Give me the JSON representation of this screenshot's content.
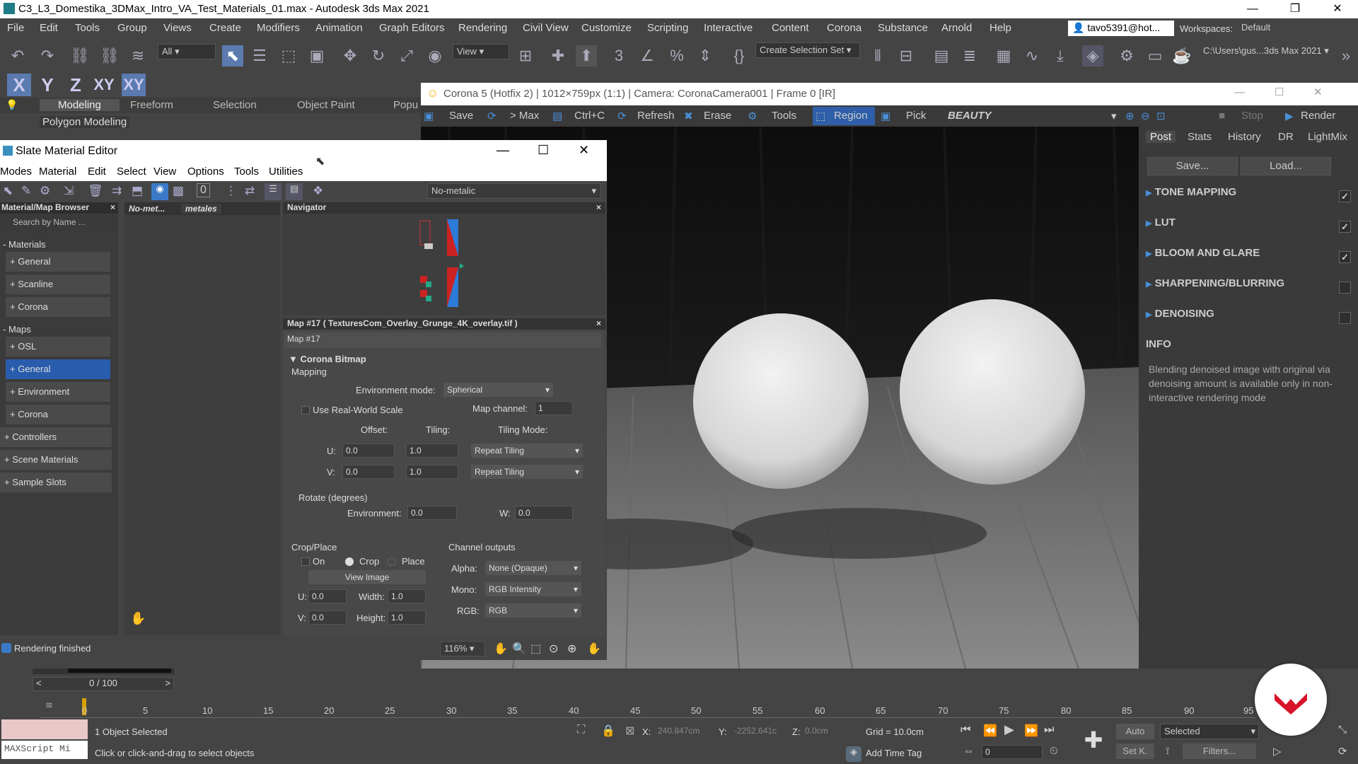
{
  "app": {
    "title": "C3_L3_Domestika_3DMax_Intro_VA_Test_Materials_01.max - Autodesk 3ds Max 2021",
    "menu": [
      "File",
      "Edit",
      "Tools",
      "Group",
      "Views",
      "Create",
      "Modifiers",
      "Animation",
      "Graph Editors",
      "Rendering",
      "Civil View",
      "Customize",
      "Scripting",
      "Interactive",
      "Content",
      "Corona",
      "Substance",
      "Arnold",
      "Help"
    ],
    "user": "tavo5391@hot...",
    "workspaces_label": "Workspaces:",
    "workspace": "Default",
    "selection_filter": "All",
    "ref_coord": "View",
    "selection_set": "Create Selection Set",
    "project_path": "C:\\Users\\gus...3ds Max 2021",
    "axes": [
      "X",
      "Y",
      "Z",
      "XY",
      "XY"
    ],
    "ribbon_tabs": [
      "Modeling",
      "Freeform",
      "Selection",
      "Object Paint",
      "Popu"
    ],
    "ribbon_sub": "Polygon Modeling"
  },
  "corona": {
    "title": "Corona 5 (Hotfix 2) | 1012×759px (1:1) | Camera: CoronaCamera001 | Frame 0 [IR]",
    "toolbar": {
      "save": "Save",
      "max": "> Max",
      "copy": "Ctrl+C",
      "refresh": "Refresh",
      "erase": "Erase",
      "tools": "Tools",
      "region": "Region",
      "pick": "Pick",
      "pass": "BEAUTY",
      "stop": "Stop",
      "render": "Render"
    },
    "panel_tabs": [
      "Post",
      "Stats",
      "History",
      "DR",
      "LightMix"
    ],
    "save_btn": "Save...",
    "load_btn": "Load...",
    "sections": [
      {
        "label": "TONE MAPPING",
        "checked": "✓"
      },
      {
        "label": "LUT",
        "checked": "✓"
      },
      {
        "label": "BLOOM AND GLARE",
        "checked": "✓"
      },
      {
        "label": "SHARPENING/BLURRING",
        "checked": ""
      },
      {
        "label": "DENOISING",
        "checked": ""
      }
    ],
    "info_title": "INFO",
    "info_text": "Blending denoised image with original via denoising amount is available only in non-interactive rendering mode"
  },
  "slate": {
    "title": "Slate Material Editor",
    "menu": [
      "Modes",
      "Material",
      "Edit",
      "Select",
      "View",
      "Options",
      "Tools",
      "Utilities"
    ],
    "view_dropdown": "No-metalic",
    "browser_title": "Material/Map Browser",
    "search_placeholder": "Search by Name ...",
    "materials_head": "- Materials",
    "materials": [
      "+ General",
      "+ Scanline",
      "+ Corona"
    ],
    "maps_head": "- Maps",
    "maps": [
      "+ OSL",
      "+ General",
      "+ Environment",
      "+ Corona"
    ],
    "extra": [
      "+ Controllers",
      "+ Scene Materials",
      "+ Sample Slots"
    ],
    "view_tabs": [
      "No-met...",
      "metales"
    ],
    "navigator": "Navigator",
    "map_header": "Map #17 ( TexturesCom_Overlay_Grunge_4K_overlay.tif )",
    "map_name": "Map #17",
    "rollout": "Corona Bitmap",
    "mapping": "Mapping",
    "env_mode_label": "Environment mode:",
    "env_mode": "Spherical",
    "real_world": "Use Real-World Scale",
    "map_channel_label": "Map channel:",
    "map_channel": "1",
    "offset": "Offset:",
    "tiling": "Tiling:",
    "tiling_mode": "Tiling Mode:",
    "u_label": "U:",
    "v_label": "V:",
    "u_offset": "0.0",
    "u_tiling": "1.0",
    "u_mode": "Repeat Tiling",
    "v_offset": "0.0",
    "v_tiling": "1.0",
    "v_mode": "Repeat Tiling",
    "rotate": "Rotate (degrees)",
    "environment_label": "Environment:",
    "environment": "0.0",
    "w_label": "W:",
    "w": "0.0",
    "crop_place": "Crop/Place",
    "on": "On",
    "crop": "Crop",
    "place": "Place",
    "view_image": "View Image",
    "crop_u_label": "U:",
    "crop_u": "0.0",
    "crop_v_label": "V:",
    "crop_v": "0.0",
    "width_label": "Width:",
    "width": "1.0",
    "height_label": "Height:",
    "height": "1.0",
    "channel_outputs": "Channel outputs",
    "alpha_label": "Alpha:",
    "alpha": "None (Opaque)",
    "mono_label": "Mono:",
    "mono": "RGB Intensity",
    "rgb_label": "RGB:",
    "rgb": "RGB",
    "status": "Rendering finished",
    "zoom": "116%"
  },
  "timeline": {
    "frame": "0 / 100",
    "ticks": [
      "0",
      "5",
      "10",
      "15",
      "20",
      "25",
      "30",
      "35",
      "40",
      "45",
      "50",
      "55",
      "60",
      "65",
      "70",
      "75",
      "80",
      "85",
      "90",
      "95"
    ]
  },
  "status": {
    "maxscript": "MAXScript Mi",
    "selected": "1 Object Selected",
    "hint": "Click or click-and-drag to select objects",
    "x_label": "X:",
    "x": "240.847cm",
    "y_label": "Y:",
    "y": "-2252.641c",
    "z_label": "Z:",
    "z": "0.0cm",
    "grid": "Grid = 10.0cm",
    "add_time_tag": "Add Time Tag",
    "auto": "Auto",
    "set_key": "Set K.",
    "key_filter": "Selected",
    "filters": "Filters...",
    "frame_field": "0"
  }
}
